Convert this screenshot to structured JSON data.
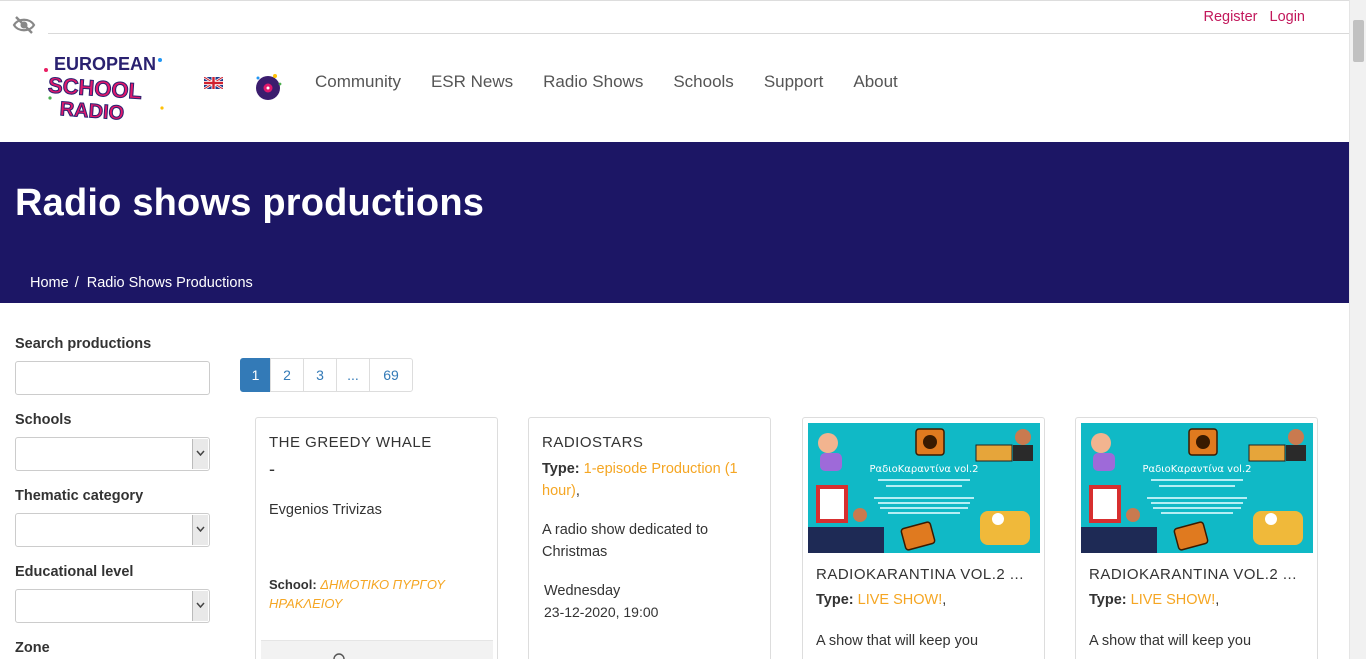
{
  "header": {
    "auth": {
      "register": "Register",
      "login": "Login"
    },
    "nav": [
      "Community",
      "ESR News",
      "Radio Shows",
      "Schools",
      "Support",
      "About"
    ],
    "logo": {
      "line1": "EUROPEAN",
      "line2": "SCHOOL",
      "line3": "RADIO"
    }
  },
  "banner": {
    "title": "Radio shows productions",
    "breadcrumb": {
      "home": "Home",
      "sep": "/",
      "current": "Radio Shows Productions"
    }
  },
  "sidebar": {
    "search_label": "Search productions",
    "search_value": "",
    "filters": [
      {
        "label": "Schools",
        "value": ""
      },
      {
        "label": "Thematic category",
        "value": ""
      },
      {
        "label": "Educational level",
        "value": ""
      },
      {
        "label": "Zone",
        "value": ""
      }
    ]
  },
  "pagination": [
    "1",
    "2",
    "3",
    "...",
    "69"
  ],
  "cards": [
    {
      "title": "THE GREEDY WHALE",
      "dash": "-",
      "author": "Evgenios Trivizas",
      "school_label": "School:",
      "school_line1": "ΔΗΜΟΤΙΚΟ ΠΥΡΓΟΥ",
      "school_line2": "ΗΡΑΚΛΕΙΟΥ"
    },
    {
      "title": "RADIOSTARS",
      "type_label": "Type:",
      "type_line1": "1-episode Production (1",
      "type_line2": "hour)",
      "type_comma": ",",
      "desc_line1": "A radio show dedicated to",
      "desc_line2": "Christmas",
      "day": "Wednesday",
      "datetime": "23-12-2020, 19:00"
    },
    {
      "title": "RADIOKARANTINA VOL.2 ...",
      "type_label": "Type:",
      "type_value": "LIVE SHOW!",
      "type_comma": ",",
      "desc": "A show that will keep you",
      "image_title": "ΡαδιοΚαραντίνα vol.2"
    },
    {
      "title": "RADIOKARANTINA VOL.2 ...",
      "type_label": "Type:",
      "type_value": "LIVE SHOW!",
      "type_comma": ",",
      "desc": "A show that will keep you",
      "image_title": "ΡαδιοΚαραντίνα vol.2"
    }
  ],
  "colors": {
    "banner": "#1c1665",
    "accent": "#c2185b",
    "link_orange": "#f5a623",
    "pager_active": "#337ab7"
  }
}
